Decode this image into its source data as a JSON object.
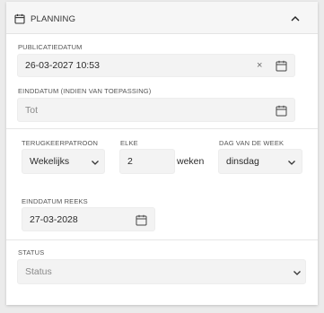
{
  "header": {
    "title": "PLANNING",
    "icon": "calendar-icon",
    "toggle_icon": "chevron-up-icon"
  },
  "publicatiedatum": {
    "label": "PUBLICATIEDATUM",
    "value": "26-03-2027 10:53",
    "clear_glyph": "×"
  },
  "einddatum": {
    "label": "EINDDATUM (INDIEN VAN TOEPASSING)",
    "placeholder": "Tot"
  },
  "recurrence": {
    "pattern_label": "TERUGKEERPATROON",
    "pattern_value": "Wekelijks",
    "every_label": "ELKE",
    "every_value": "2",
    "every_unit": "weken",
    "weekday_label": "DAG VAN DE WEEK",
    "weekday_value": "dinsdag"
  },
  "series_end": {
    "label": "EINDDATUM REEKS",
    "value": "27-03-2028"
  },
  "status": {
    "label": "STATUS",
    "placeholder": "Status"
  }
}
